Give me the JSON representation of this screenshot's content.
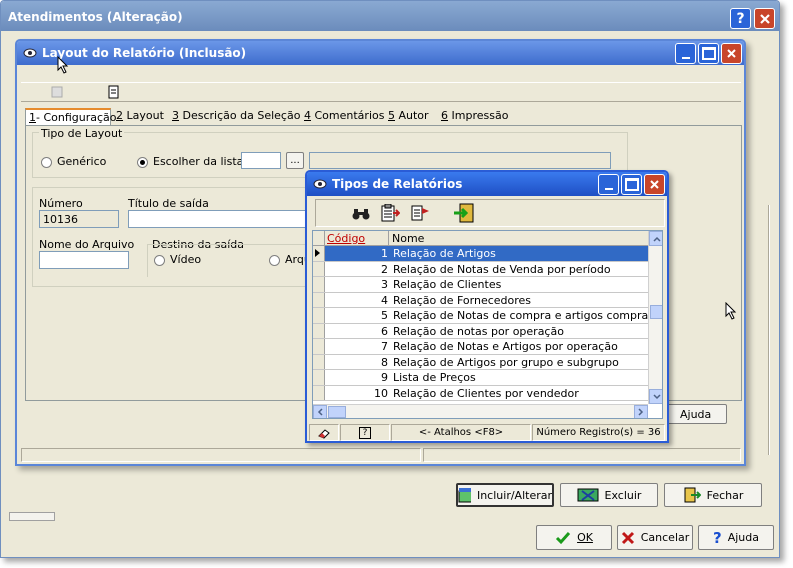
{
  "main_window": {
    "title": "Atendimentos (Alteração)",
    "buttons": {
      "ok": "OK",
      "cancel": "Cancelar",
      "help": "Ajuda",
      "include": "Incluir/Alterar",
      "delete": "Excluir",
      "close": "Fechar"
    }
  },
  "layout_window": {
    "title": "Layout do Relatório (Inclusão)",
    "tabs": [
      {
        "num": "1",
        "label": "Configuração"
      },
      {
        "num": "2",
        "label": "Layout"
      },
      {
        "num": "3",
        "label": "Descrição da Seleção"
      },
      {
        "num": "4",
        "label": "Comentários"
      },
      {
        "num": "5",
        "label": "Autor"
      },
      {
        "num": "6",
        "label": "Impressão"
      }
    ],
    "tipo_layout": {
      "legend": "Tipo de Layout",
      "generic": "Genérico",
      "choose": "Escolher da lista:",
      "ellipsis": "..."
    },
    "numero_label": "Número",
    "numero_value": "10136",
    "titulo_label": "Título de saída",
    "arquivo_label": "Nome do Arquivo",
    "destino_label": "Destino da saída",
    "video": "Vídeo",
    "arquivo_partial": "Arqu",
    "help": "Ajuda"
  },
  "tipos_window": {
    "title": "Tipos de Relatórios",
    "columns": {
      "code": "Código",
      "name": "Nome"
    },
    "rows": [
      {
        "code": "1",
        "name": "Relação de Artigos"
      },
      {
        "code": "2",
        "name": "Relação de Notas de Venda por período"
      },
      {
        "code": "3",
        "name": "Relação de Clientes"
      },
      {
        "code": "4",
        "name": "Relação de Fornecedores"
      },
      {
        "code": "5",
        "name": "Relação de Notas de compra e artigos comprados"
      },
      {
        "code": "6",
        "name": "Relação de notas por operação"
      },
      {
        "code": "7",
        "name": "Relação de Notas e Artigos por operação"
      },
      {
        "code": "8",
        "name": "Relação de Artigos por grupo e subgrupo"
      },
      {
        "code": "9",
        "name": "Lista de Preços"
      },
      {
        "code": "10",
        "name": "Relação de Clientes por vendedor"
      }
    ],
    "status": {
      "shortcuts": "<- Atalhos <F8>",
      "count": "Número Registro(s) = 36",
      "help_glyph": "?"
    }
  }
}
